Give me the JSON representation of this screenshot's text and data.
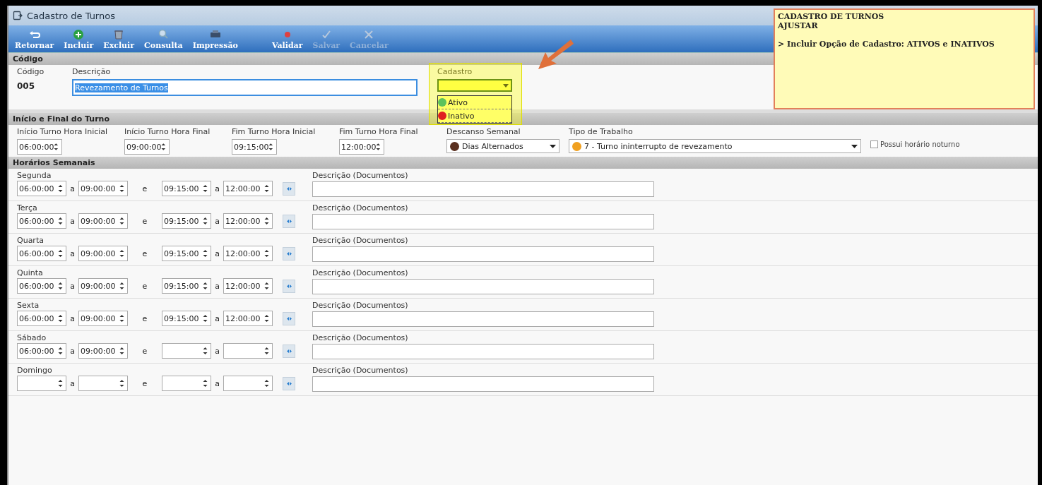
{
  "window": {
    "title": "Cadastro de Turnos"
  },
  "toolbar": [
    {
      "label": "Retornar",
      "disabled": false
    },
    {
      "label": "Incluir",
      "disabled": false
    },
    {
      "label": "Excluir",
      "disabled": false
    },
    {
      "label": "Consulta",
      "disabled": false
    },
    {
      "label": "Impressão",
      "disabled": false
    },
    {
      "label": "Validar",
      "disabled": false
    },
    {
      "label": "Salvar",
      "disabled": true
    },
    {
      "label": "Cancelar",
      "disabled": true
    }
  ],
  "codigo_section": {
    "title": "Código",
    "code_label": "Código",
    "code_value": "005",
    "description_label": "Descrição",
    "description_value": "Revezamento de Turnos",
    "cadastro": {
      "label": "Cadastro",
      "expanded": true,
      "options": [
        {
          "label": "Ativo",
          "color": "#5cc25c",
          "selected": false
        },
        {
          "label": "Inativo",
          "color": "#e02020",
          "selected": false
        }
      ]
    }
  },
  "turno_section": {
    "title": "Início e Final do Turno",
    "times": [
      {
        "label": "Início Turno Hora Inicial",
        "value": "06:00:00"
      },
      {
        "label": "Início Turno Hora Final",
        "value": "09:00:00"
      },
      {
        "label": "Fim Turno Hora Inicial",
        "value": "09:15:00"
      },
      {
        "label": "Fim Turno Hora Final",
        "value": "12:00:00"
      }
    ],
    "descanso": {
      "label": "Descanso Semanal",
      "value": "Dias Alternados",
      "color": "#5a3020"
    },
    "tipo": {
      "label": "Tipo de Trabalho",
      "value": "7 - Turno ininterrupto de revezamento",
      "color": "#f0a020"
    },
    "noturno": {
      "label": "Possui horário noturno",
      "checked": false
    }
  },
  "weekly_section": {
    "title": "Horários Semanais",
    "days": [
      {
        "day": "Segunda",
        "start_1": "06:00:00",
        "end_1": "09:00:00",
        "start_2": "09:15:00",
        "end_2": "12:00:00",
        "joins": [
          "a",
          "e",
          "a"
        ],
        "doc_label": "Descrição (Documentos)"
      },
      {
        "day": "Terça",
        "start_1": "06:00:00",
        "end_1": "09:00:00",
        "start_2": "09:15:00",
        "end_2": "12:00:00",
        "joins": [
          "a",
          "e",
          "a"
        ],
        "doc_label": "Descrição (Documentos)"
      },
      {
        "day": "Quarta",
        "start_1": "06:00:00",
        "end_1": "09:00:00",
        "start_2": "09:15:00",
        "end_2": "12:00:00",
        "joins": [
          "a",
          "e",
          "a"
        ],
        "doc_label": "Descrição (Documentos)"
      },
      {
        "day": "Quinta",
        "start_1": "06:00:00",
        "end_1": "09:00:00",
        "start_2": "09:15:00",
        "end_2": "12:00:00",
        "joins": [
          "a",
          "e",
          "a"
        ],
        "doc_label": "Descrição (Documentos)"
      },
      {
        "day": "Sexta",
        "start_1": "06:00:00",
        "end_1": "09:00:00",
        "start_2": "09:15:00",
        "end_2": "12:00:00",
        "joins": [
          "a",
          "e",
          "a"
        ],
        "doc_label": "Descrição (Documentos)"
      },
      {
        "day": "Sábado",
        "start_1": "06:00:00",
        "end_1": "09:00:00",
        "joins": [
          "a",
          "e",
          "a"
        ],
        "doc_label": "Descrição (Documentos)"
      },
      {
        "day": "Domingo",
        "joins": [
          "a",
          "e",
          "a"
        ],
        "doc_label": "Descrição (Documentos)"
      }
    ]
  },
  "note": {
    "lines": [
      "CADASTRO DE TURNOS",
      "AJUSTAR",
      "> Incluir Opção de Cadastro: ATIVOS e INATIVOS"
    ]
  }
}
